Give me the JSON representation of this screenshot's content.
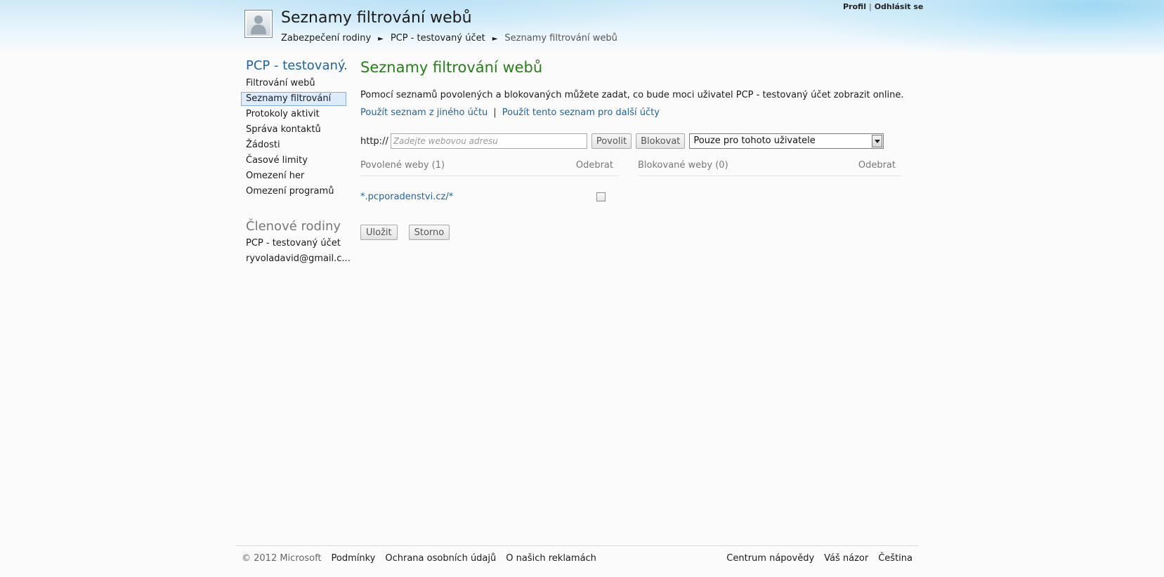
{
  "header": {
    "title": "Seznamy filtrování webů",
    "account": {
      "profile": "Profil",
      "separator": "|",
      "sign_out": "Odhlásit se"
    },
    "breadcrumb": {
      "items": [
        "Zabezpečení rodiny",
        "PCP - testovaný účet",
        "Seznamy filtrování webů"
      ],
      "arrow": "►"
    }
  },
  "sidebar": {
    "heading": "PCP - testovaný...",
    "items": [
      "Filtrování webů",
      "Seznamy filtrování",
      "Protokoly aktivit",
      "Správa kontaktů",
      "Žádosti",
      "Časové limity",
      "Omezení her",
      "Omezení programů"
    ],
    "members_heading": "Členové rodiny",
    "members": [
      "PCP - testovaný účet",
      "ryvoladavid@gmail.c..."
    ]
  },
  "main": {
    "title": "Seznamy filtrování webů",
    "description": "Pomocí seznamů povolených a blokovaných můžete zadat, co bude moci uživatel PCP - testovaný účet zobrazit online.",
    "link_other_account": "Použít seznam z jiného účtu",
    "link_separator": "|",
    "link_other_accounts": "Použít tento seznam pro další účty",
    "url_prefix": "http://",
    "url_placeholder": "Zadejte webovou adresu",
    "allow_button": "Povolit",
    "block_button": "Blokovat",
    "scope_select": "Pouze pro tohoto uživatele",
    "allowed_heading": "Povolené weby (1)",
    "blocked_heading": "Blokované weby (0)",
    "remove_label": "Odebrat",
    "allowed_sites": [
      "*.pcporadenstvi.cz/*"
    ],
    "save_button": "Uložit",
    "cancel_button": "Storno"
  },
  "footer": {
    "copyright": "© 2012 Microsoft",
    "links_left": [
      "Podmínky",
      "Ochrana osobních údajů",
      "O našich reklamách"
    ],
    "links_right": [
      "Centrum nápovědy",
      "Váš názor",
      "Čeština"
    ]
  }
}
